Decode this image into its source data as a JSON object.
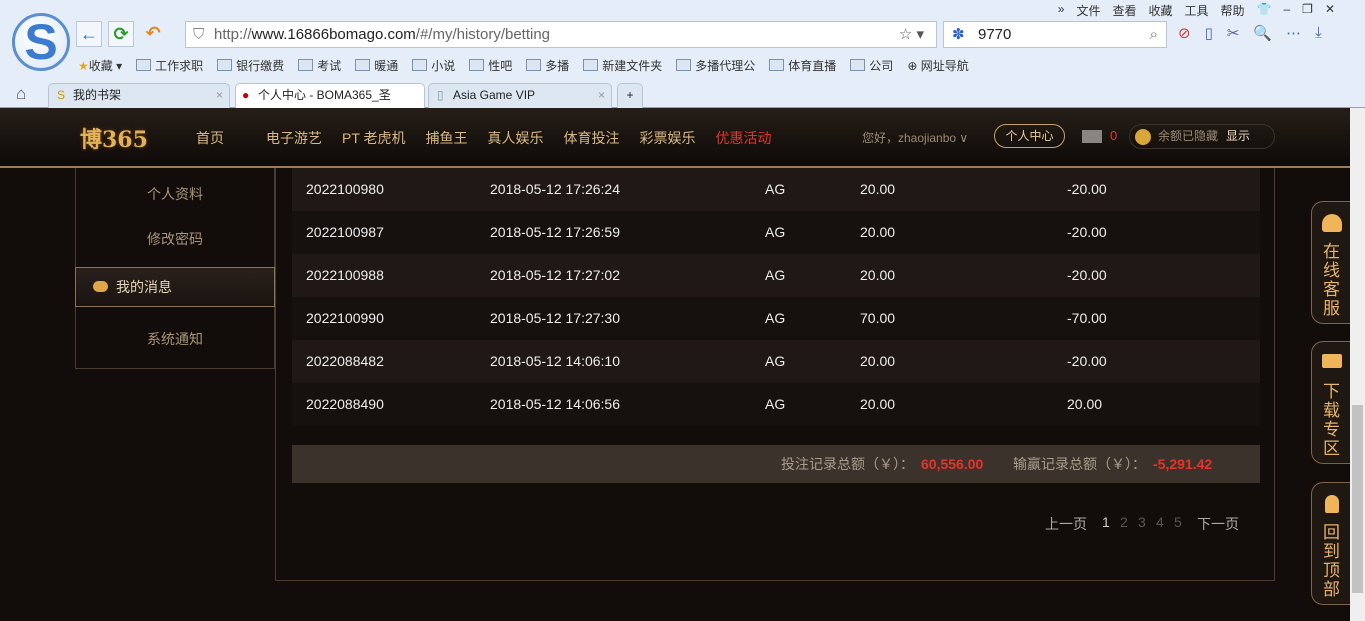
{
  "browser": {
    "menu": [
      "»",
      "文件",
      "查看",
      "收藏",
      "工具",
      "帮助"
    ],
    "url_prefix": "http://",
    "url_host": "www.16866bomago.com",
    "url_path": "/#/my/history/betting",
    "search_value": "9770",
    "bookmarks": [
      "收藏",
      "工作求职",
      "银行缴费",
      "考试",
      "暖通",
      "小说",
      "性吧",
      "多播",
      "新建文件夹",
      "多播代理公",
      "体育直播",
      "公司",
      "网址导航"
    ],
    "tabs": [
      {
        "label": "我的书架"
      },
      {
        "label": "个人中心 - BOMA365_圣"
      },
      {
        "label": "Asia Game VIP"
      }
    ],
    "new_tab": "+"
  },
  "site": {
    "brand": "博365",
    "nav": [
      "首页",
      "电子游艺",
      "PT 老虎机",
      "捕鱼王",
      "真人娱乐",
      "体育投注",
      "彩票娱乐",
      "优惠活动"
    ],
    "greeting": "您好，zhaojianbo ∨",
    "personal_center": "个人中心",
    "message_count": "0",
    "balance_hidden": "余额已隐藏",
    "show": "显示"
  },
  "sidebar": [
    "个人资料",
    "修改密码",
    "我的消息",
    "系统通知"
  ],
  "table": {
    "rows": [
      [
        "2022100980",
        "2018-05-12 17:26:24",
        "AG",
        "20.00",
        "-20.00"
      ],
      [
        "2022100987",
        "2018-05-12 17:26:59",
        "AG",
        "20.00",
        "-20.00"
      ],
      [
        "2022100988",
        "2018-05-12 17:27:02",
        "AG",
        "20.00",
        "-20.00"
      ],
      [
        "2022100990",
        "2018-05-12 17:27:30",
        "AG",
        "70.00",
        "-70.00"
      ],
      [
        "2022088482",
        "2018-05-12 14:06:10",
        "AG",
        "20.00",
        "-20.00"
      ],
      [
        "2022088490",
        "2018-05-12 14:06:56",
        "AG",
        "20.00",
        "20.00"
      ]
    ]
  },
  "totals": {
    "bet_label": "投注记录总额（￥）：",
    "bet_value": "60,556.00",
    "win_label": "输赢记录总额（￥）：",
    "win_value": "-5,291.42"
  },
  "pagination": {
    "prev": "上一页",
    "pages": [
      "1",
      "2",
      "3",
      "4",
      "5"
    ],
    "next": "下一页",
    "current": "1"
  },
  "float": [
    {
      "label": "在线客服"
    },
    {
      "label": "下载专区"
    },
    {
      "label": "回到顶部"
    }
  ],
  "colors": {
    "accent": "#d9b884",
    "promo": "#e8332a",
    "background": "#120d0b"
  }
}
